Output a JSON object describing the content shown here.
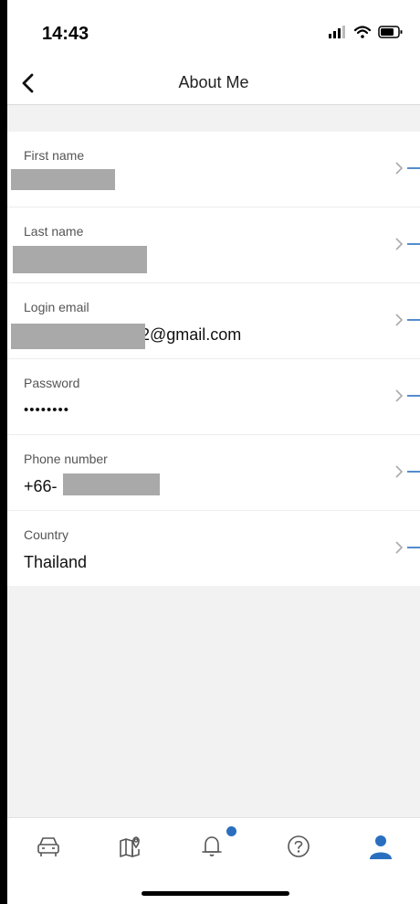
{
  "status_bar": {
    "time": "14:43",
    "icons": [
      "cellular-signal-icon",
      "wifi-icon",
      "battery-icon"
    ]
  },
  "header": {
    "back_icon": "chevron-left-icon",
    "title": "About Me"
  },
  "fields": [
    {
      "id": "first-name",
      "label": "First name",
      "value": "",
      "redacted": true
    },
    {
      "id": "last-name",
      "label": "Last name",
      "value": "",
      "redacted": true
    },
    {
      "id": "login-email",
      "label": "Login email",
      "value": "2@gmail.com",
      "redacted": true
    },
    {
      "id": "password",
      "label": "Password",
      "value": "••••••••",
      "redacted": false
    },
    {
      "id": "phone-number",
      "label": "Phone number",
      "value": "+66-",
      "redacted": true
    },
    {
      "id": "country",
      "label": "Country",
      "value": "Thailand",
      "redacted": false
    }
  ],
  "tab_bar": {
    "tabs": [
      {
        "icon": "car-icon",
        "active": false
      },
      {
        "icon": "map-pin-icon",
        "active": false
      },
      {
        "icon": "bell-icon",
        "active": false,
        "badge": true
      },
      {
        "icon": "help-icon",
        "active": false
      },
      {
        "icon": "person-icon",
        "active": true
      }
    ]
  },
  "colors": {
    "accent": "#2a6fbf",
    "redaction": "#a9a9a9",
    "background": "#f2f2f2"
  }
}
